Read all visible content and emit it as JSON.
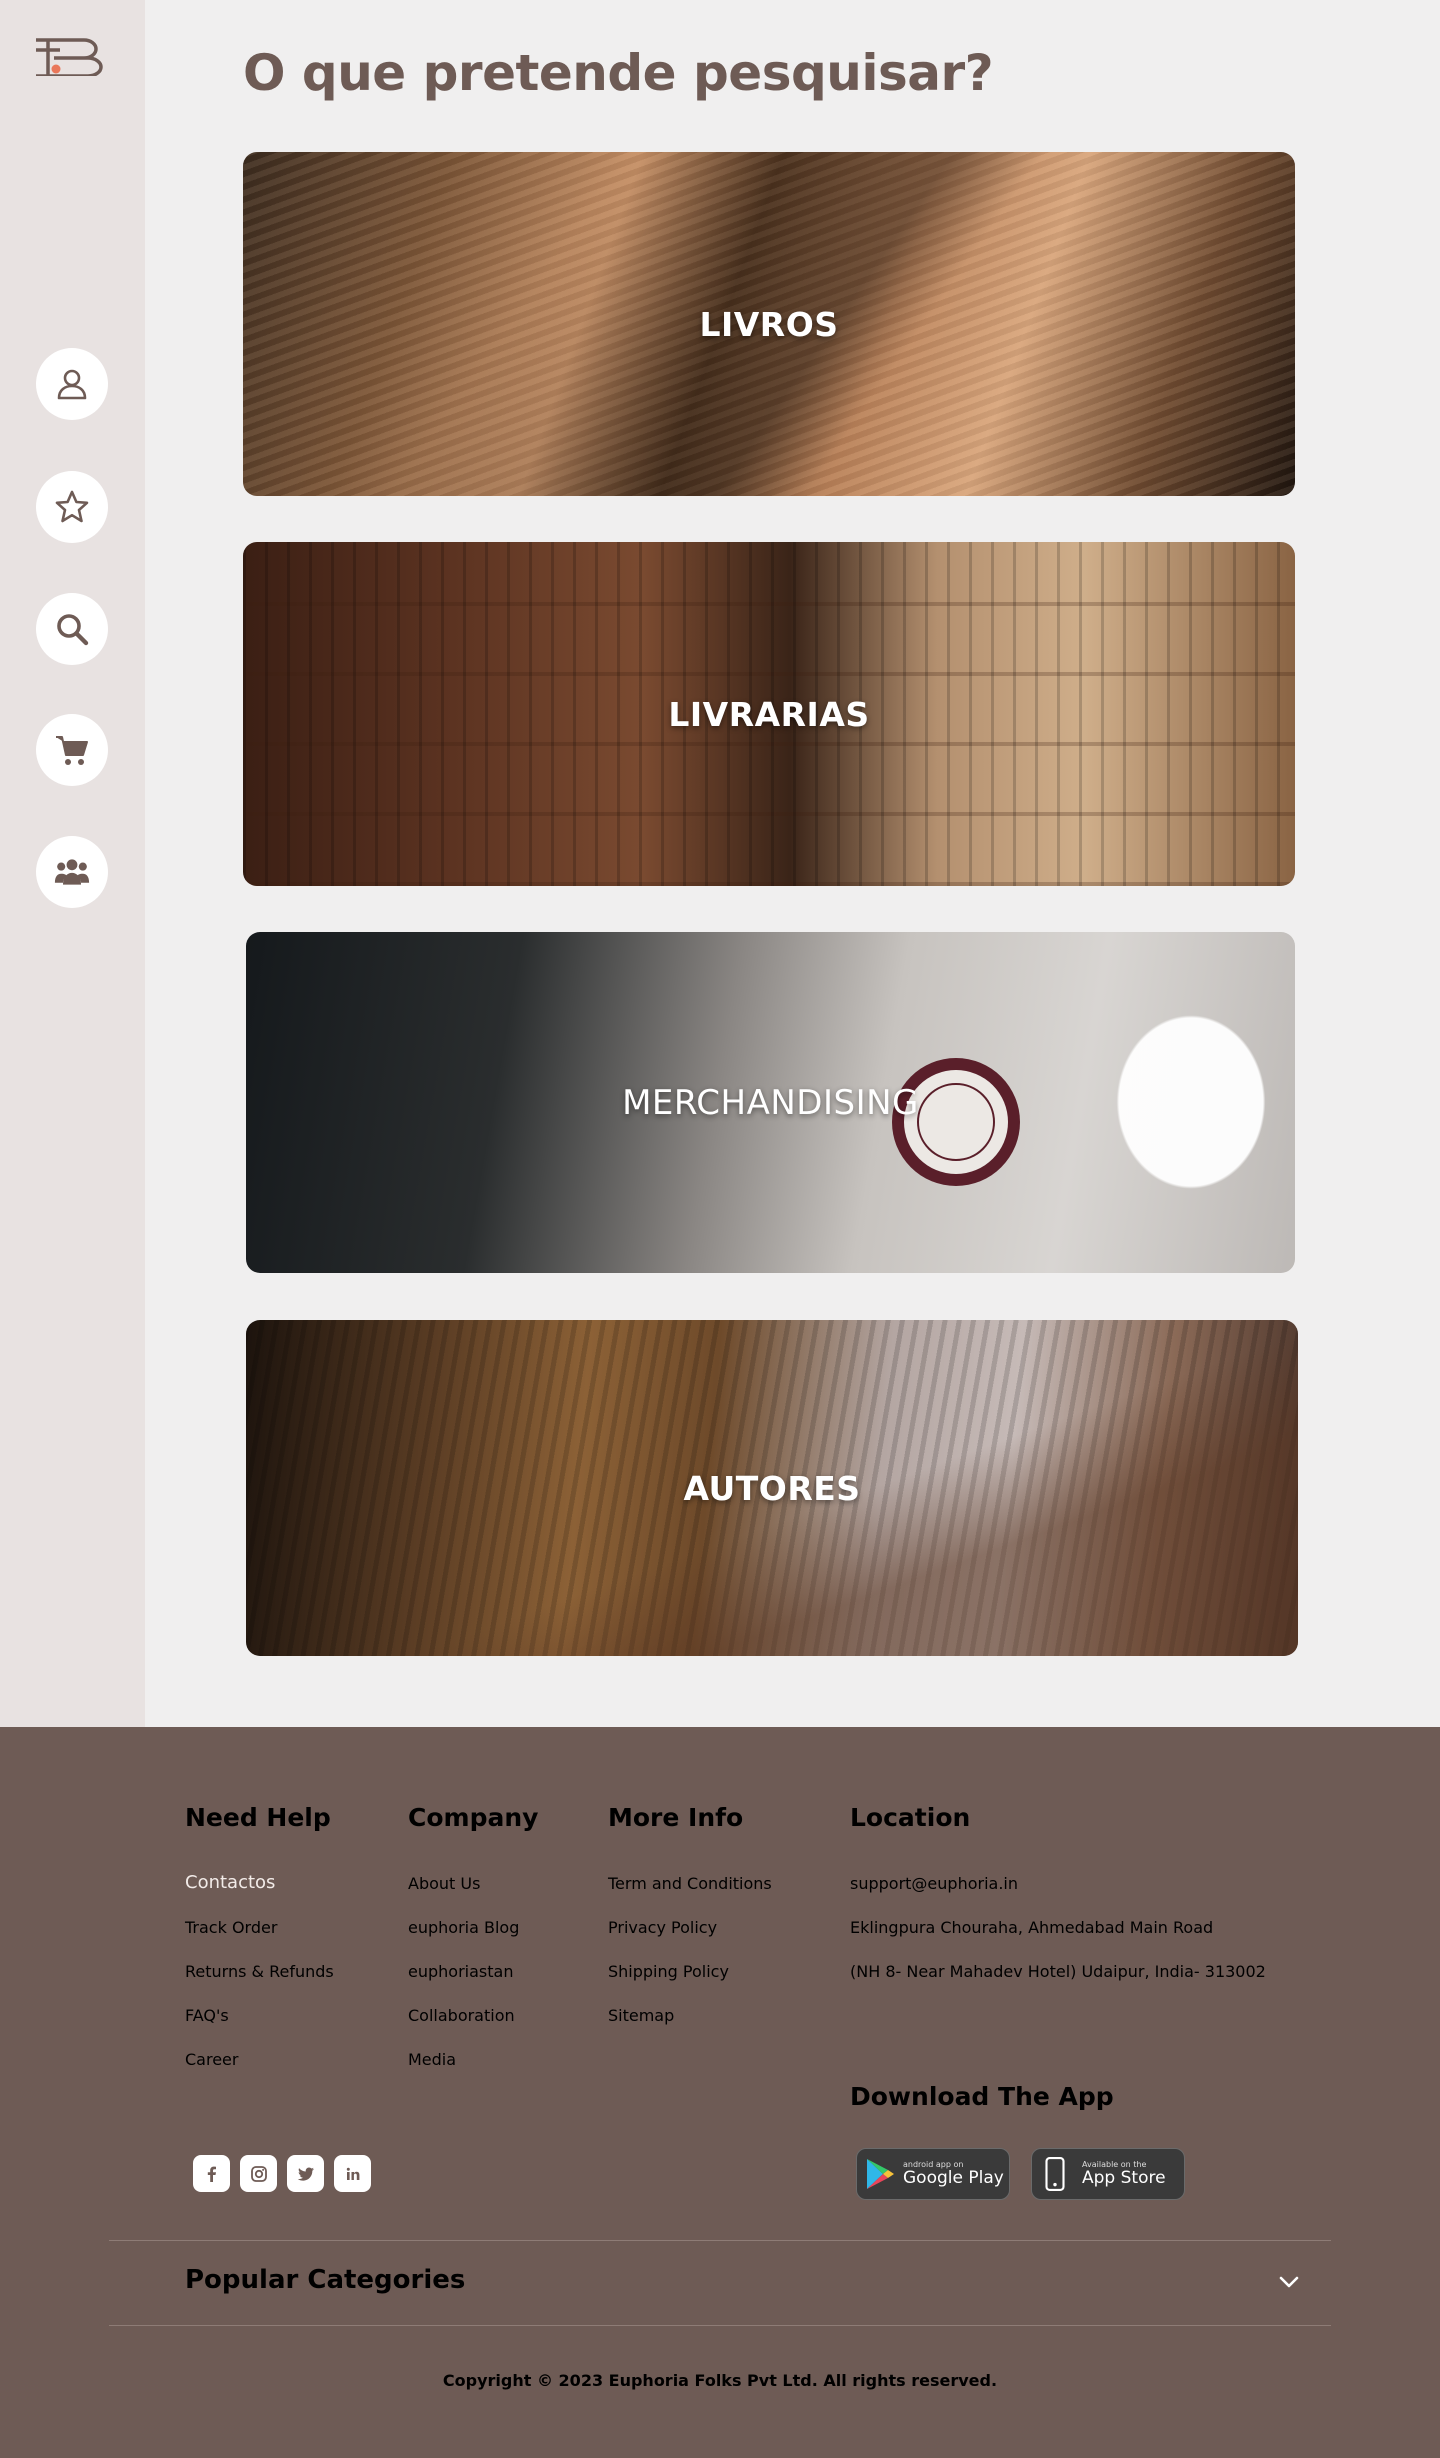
{
  "page": {
    "title": "O que pretende pesquisar?"
  },
  "sidebar": {
    "logo": "logo-mark",
    "items": [
      {
        "name": "profile",
        "icon": "user-icon"
      },
      {
        "name": "favorites",
        "icon": "star-icon"
      },
      {
        "name": "search",
        "icon": "search-icon"
      },
      {
        "name": "cart",
        "icon": "cart-icon"
      },
      {
        "name": "community",
        "icon": "users-icon"
      }
    ]
  },
  "categories": [
    {
      "label": "LIVROS"
    },
    {
      "label": "LIVRARIAS"
    },
    {
      "label": "MERCHANDISING"
    },
    {
      "label": "AUTORES"
    }
  ],
  "footer": {
    "need_help": {
      "title": "Need Help",
      "links": [
        "Contactos",
        "Track Order",
        "Returns & Refunds",
        "FAQ's",
        "Career"
      ]
    },
    "company": {
      "title": "Company",
      "links": [
        "About Us",
        "euphoria Blog",
        "euphoriastan",
        "Collaboration",
        "Media"
      ]
    },
    "more_info": {
      "title": "More Info",
      "links": [
        "Term and Conditions",
        "Privacy Policy",
        "Shipping Policy",
        "Sitemap"
      ]
    },
    "location": {
      "title": "Location",
      "lines": [
        "support@euphoria.in",
        "Eklingpura Chouraha, Ahmedabad Main Road",
        "(NH 8- Near Mahadev Hotel) Udaipur, India- 313002"
      ]
    },
    "download": {
      "title": "Download The App",
      "google_small": "android app on",
      "google_big": "Google Play",
      "apple_small": "Available on the",
      "apple_big": "App Store"
    },
    "social": [
      "facebook-icon",
      "instagram-icon",
      "twitter-icon",
      "linkedin-icon"
    ],
    "popular_categories": "Popular Categories",
    "copyright": "Copyright © 2023 Euphoria Folks Pvt Ltd. All rights reserved."
  },
  "colors": {
    "accent": "#6e5b55",
    "sidebar_bg": "#e8e2e1",
    "page_bg": "#f0efef",
    "logo_dot": "#e9775a"
  }
}
